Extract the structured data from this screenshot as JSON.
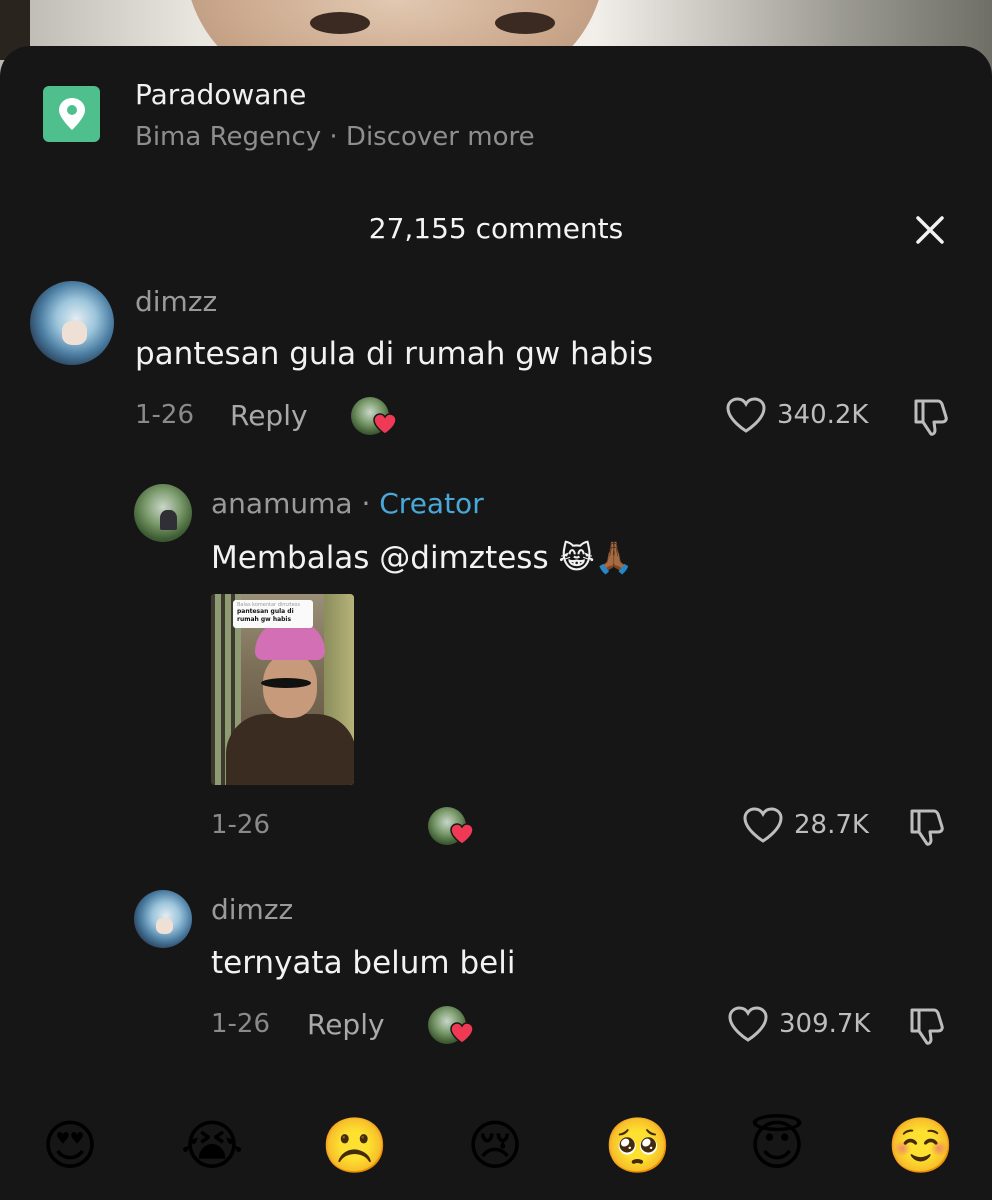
{
  "location": {
    "title": "Paradowane",
    "subtitle": "Bima Regency · Discover more",
    "icon": "location-pin-icon",
    "accent": "#4fc08d"
  },
  "header": {
    "comment_count": "27,155 comments",
    "close_icon": "close-icon"
  },
  "comments": [
    {
      "username": "dimzz",
      "text": "pantesan gula di rumah gw habis",
      "date": "1-26",
      "reply_label": "Reply",
      "likes": "340.2K",
      "liked_by_creator": true
    },
    {
      "username": "anamuma",
      "separator": "·",
      "role": "Creator",
      "text": "Membalas @dimztess 😹🙏🏾",
      "date": "1-26",
      "likes": "28.7K",
      "liked_by_creator": true,
      "thumbnail": {
        "caption_small": "Balas komentar dimztess",
        "caption": "pantesan gula di rumah gw habis"
      }
    },
    {
      "username": "dimzz",
      "text": "ternyata belum beli",
      "date": "1-26",
      "reply_label": "Reply",
      "likes": "309.7K",
      "liked_by_creator": true
    }
  ],
  "emoji_bar": [
    "😍",
    "😭",
    "☹️",
    "😢",
    "🥺",
    "😇",
    "☺️"
  ]
}
